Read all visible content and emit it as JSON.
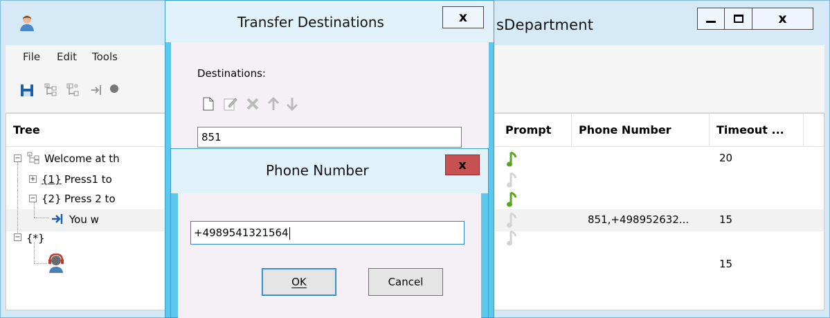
{
  "main_window": {
    "title": "sDepartment",
    "menu": [
      "File",
      "Edit",
      "Tools"
    ],
    "columns": {
      "tree": "Tree",
      "prompt": "Prompt",
      "phone_number": "Phone Number",
      "timeout": "Timeout ..."
    },
    "rows": [
      {
        "tree": "Welcome at th",
        "prompt_active": true,
        "phone": "",
        "timeout": "20"
      },
      {
        "tree_id": "{1}",
        "tree": "Press1 to",
        "prompt_active": false,
        "phone": "",
        "timeout": ""
      },
      {
        "tree_id": "{2}",
        "tree": "Press 2 to",
        "prompt_active": true,
        "phone": "",
        "timeout": ""
      },
      {
        "tree": "You w",
        "prompt_active": false,
        "phone": "851,+498952632...",
        "timeout": "15"
      },
      {
        "tree_id": "{*}",
        "tree": "",
        "prompt_active": false,
        "phone": "",
        "timeout": ""
      },
      {
        "tree": "",
        "prompt_active": null,
        "phone": "",
        "timeout": "15"
      }
    ]
  },
  "transfer_dialog": {
    "title": "Transfer Destinations",
    "close_label": "x",
    "destinations_label": "Destinations:",
    "destination_value": "851"
  },
  "phone_dialog": {
    "title": "Phone Number",
    "close_label": "x",
    "input_value": "+4989541321564",
    "ok_label": "OK",
    "cancel_label": "Cancel"
  },
  "colors": {
    "accent_frame": "#5dc8ee",
    "close_red": "#c75050",
    "prompt_active": "#5aa51e",
    "prompt_inactive": "#d3d3d3"
  }
}
